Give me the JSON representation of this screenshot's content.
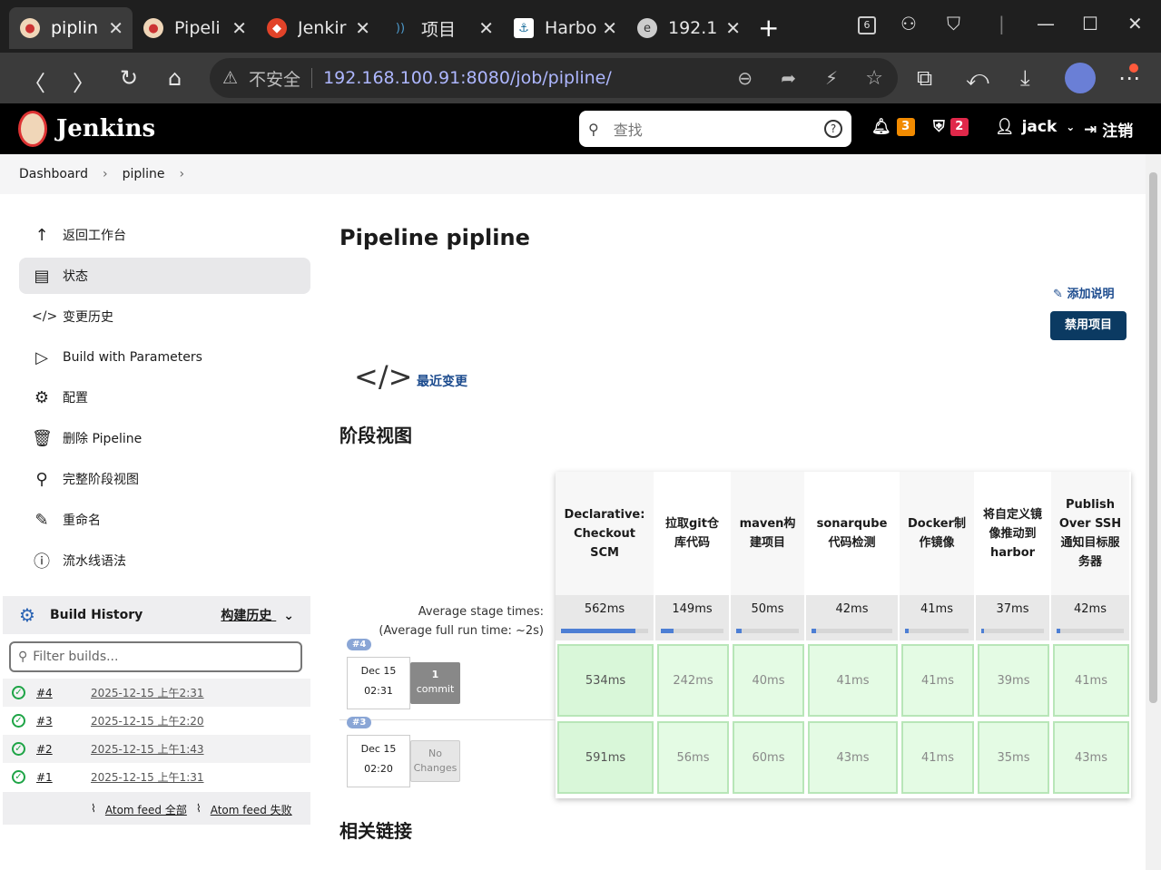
{
  "browser": {
    "tabs": [
      {
        "title": "piplin",
        "icon": "jenkins-icon",
        "active": true
      },
      {
        "title": "Pipeli",
        "icon": "jenkins-icon",
        "active": false
      },
      {
        "title": "Jenkir",
        "icon": "gitlab-icon",
        "active": false
      },
      {
        "title": "项目",
        "icon": "sonar-icon",
        "active": false
      },
      {
        "title": "Harbo",
        "icon": "harbor-icon",
        "active": false
      },
      {
        "title": "192.1",
        "icon": "edge-icon",
        "active": false
      }
    ],
    "tab_counter": "6",
    "security_label": "不安全",
    "url": "192.168.100.91:8080/job/pipline/"
  },
  "header": {
    "brand": "Jenkins",
    "search_placeholder": "查找",
    "notifications_count": "3",
    "security_count": "2",
    "user": "jack",
    "logout": "注销",
    "colors": {
      "notif": "#f28b00",
      "security": "#e0284a"
    }
  },
  "breadcrumb": [
    "Dashboard",
    "pipline"
  ],
  "sidebar": {
    "items": [
      {
        "label": "返回工作台",
        "icon": "arrow-up-icon"
      },
      {
        "label": "状态",
        "icon": "document-icon",
        "active": true
      },
      {
        "label": "变更历史",
        "icon": "code-icon"
      },
      {
        "label": "Build with Parameters",
        "icon": "play-icon"
      },
      {
        "label": "配置",
        "icon": "gear-icon"
      },
      {
        "label": "删除 Pipeline",
        "icon": "trash-icon"
      },
      {
        "label": "完整阶段视图",
        "icon": "search-icon"
      },
      {
        "label": "重命名",
        "icon": "pencil-icon"
      },
      {
        "label": "流水线语法",
        "icon": "help-icon"
      }
    ],
    "build_history": {
      "title": "Build History",
      "toggle": "构建历史",
      "filter_placeholder": "Filter builds...",
      "builds": [
        {
          "num": "#4",
          "date": "2025-12-15 上午2:31"
        },
        {
          "num": "#3",
          "date": "2025-12-15 上午2:20"
        },
        {
          "num": "#2",
          "date": "2025-12-15 上午1:43"
        },
        {
          "num": "#1",
          "date": "2025-12-15 上午1:31"
        }
      ],
      "atom_all": "Atom feed 全部",
      "atom_fail": "Atom feed 失败"
    }
  },
  "main": {
    "title": "Pipeline pipline",
    "add_description": "添加说明",
    "disable_button": "禁用项目",
    "recent_changes": "最近变更",
    "stage_view_title": "阶段视图",
    "related_links_title": "相关链接",
    "avg_label_1": "Average stage times:",
    "avg_label_2": "(Average full run time: ~2s)",
    "stages": [
      {
        "name": "Declarative: Checkout SCM",
        "avg": "562ms",
        "fill": 0.85
      },
      {
        "name": "拉取git仓库代码",
        "avg": "149ms",
        "fill": 0.2
      },
      {
        "name": "maven构建项目",
        "avg": "50ms",
        "fill": 0.08
      },
      {
        "name": "sonarqube代码检测",
        "avg": "42ms",
        "fill": 0.06
      },
      {
        "name": "Docker制作镜像",
        "avg": "41ms",
        "fill": 0.06
      },
      {
        "name": "将自定义镜像推动到harbor",
        "avg": "37ms",
        "fill": 0.05
      },
      {
        "name": "Publish Over SSH通知目标服务器",
        "avg": "42ms",
        "fill": 0.06
      }
    ],
    "runs": [
      {
        "tag": "#4",
        "date": "Dec 15",
        "time": "02:31",
        "changes_a": "1",
        "changes_b": "commit",
        "durations": [
          "534ms",
          "242ms",
          "40ms",
          "41ms",
          "41ms",
          "39ms",
          "41ms"
        ]
      },
      {
        "tag": "#3",
        "date": "Dec 15",
        "time": "02:20",
        "changes_a": "No",
        "changes_b": "Changes",
        "durations": [
          "591ms",
          "56ms",
          "60ms",
          "43ms",
          "41ms",
          "35ms",
          "43ms"
        ]
      }
    ]
  }
}
